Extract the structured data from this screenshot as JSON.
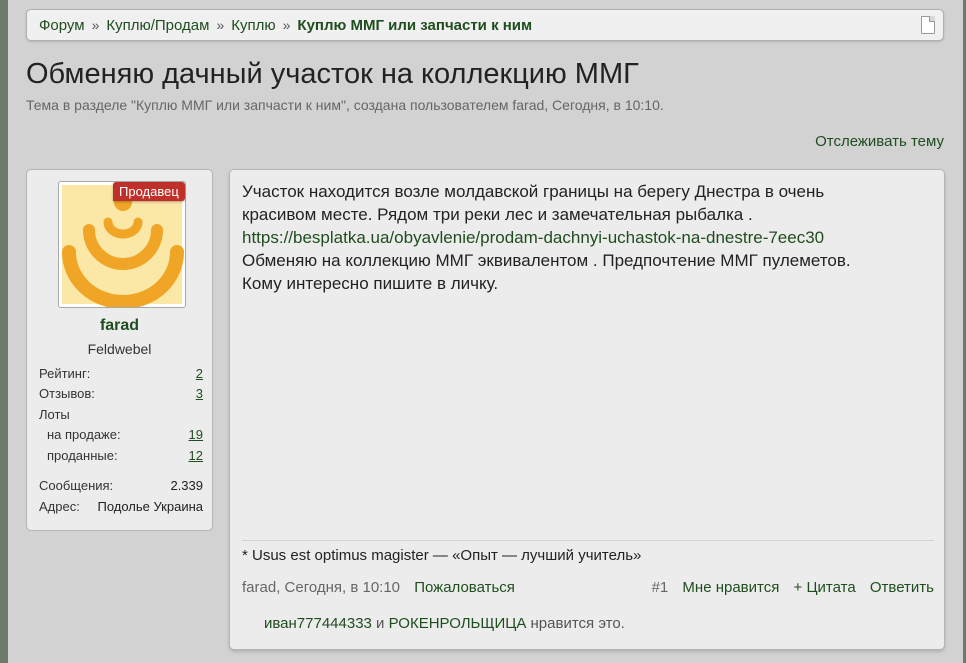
{
  "breadcrumb": {
    "items": [
      "Форум",
      "Куплю/Продам",
      "Куплю"
    ],
    "current": "Куплю ММГ или запчасти к ним",
    "separator": "»"
  },
  "thread": {
    "title": "Обменяю дачный участок на коллекцию ММГ",
    "subtitle": "Тема в разделе \"Куплю ММГ или запчасти к ним\", создана пользователем farad, Сегодня, в 10:10.",
    "watch_label": "Отслеживать тему"
  },
  "user": {
    "badge": "Продавец",
    "name": "farad",
    "rank": "Feldwebel",
    "stats": {
      "rating_label": "Рейтинг:",
      "rating": "2",
      "reviews_label": "Отзывов:",
      "reviews": "3",
      "lots_label": "Лоты",
      "on_sale_label": "на продаже:",
      "on_sale": "19",
      "sold_label": "проданные:",
      "sold": "12",
      "messages_label": "Сообщения:",
      "messages": "2.339",
      "address_label": "Адрес:",
      "address": "Подолье Украина"
    },
    "avatar_colors": {
      "background": "#fbe7a6",
      "logo": "#f0a526"
    }
  },
  "post": {
    "line1": "Участок находится возле молдавской границы на берегу Днестра в очень",
    "line2": "красивом месте. Рядом три реки лес и замечательная рыбалка .",
    "link": "https://besplatka.ua/obyavlenie/prodam-dachnyi-uchastok-na-dnestre-7eec30",
    "line3": "Обменяю на коллекцию ММГ эквивалентом . Предпочтение ММГ пулеметов.",
    "line4": "Кому интересно пишите в личку.",
    "signature": "* Usus est optimus magister — «Опыт — лучший учитель»",
    "meta": "farad, Сегодня, в 10:10",
    "report": "Пожаловаться",
    "number": "#1",
    "like": "Мне нравится",
    "quote": "+ Цитата",
    "reply": "Ответить",
    "likes": {
      "user1": "иван777444333",
      "and": " и ",
      "user2": "РОКЕНРОЛЬЩИЦА",
      "suffix": " нравится это."
    }
  },
  "colors": {
    "accent": "#1f4d1f",
    "badge": "#c0302a",
    "panel": "#ececec",
    "page": "#d2d2d2"
  }
}
